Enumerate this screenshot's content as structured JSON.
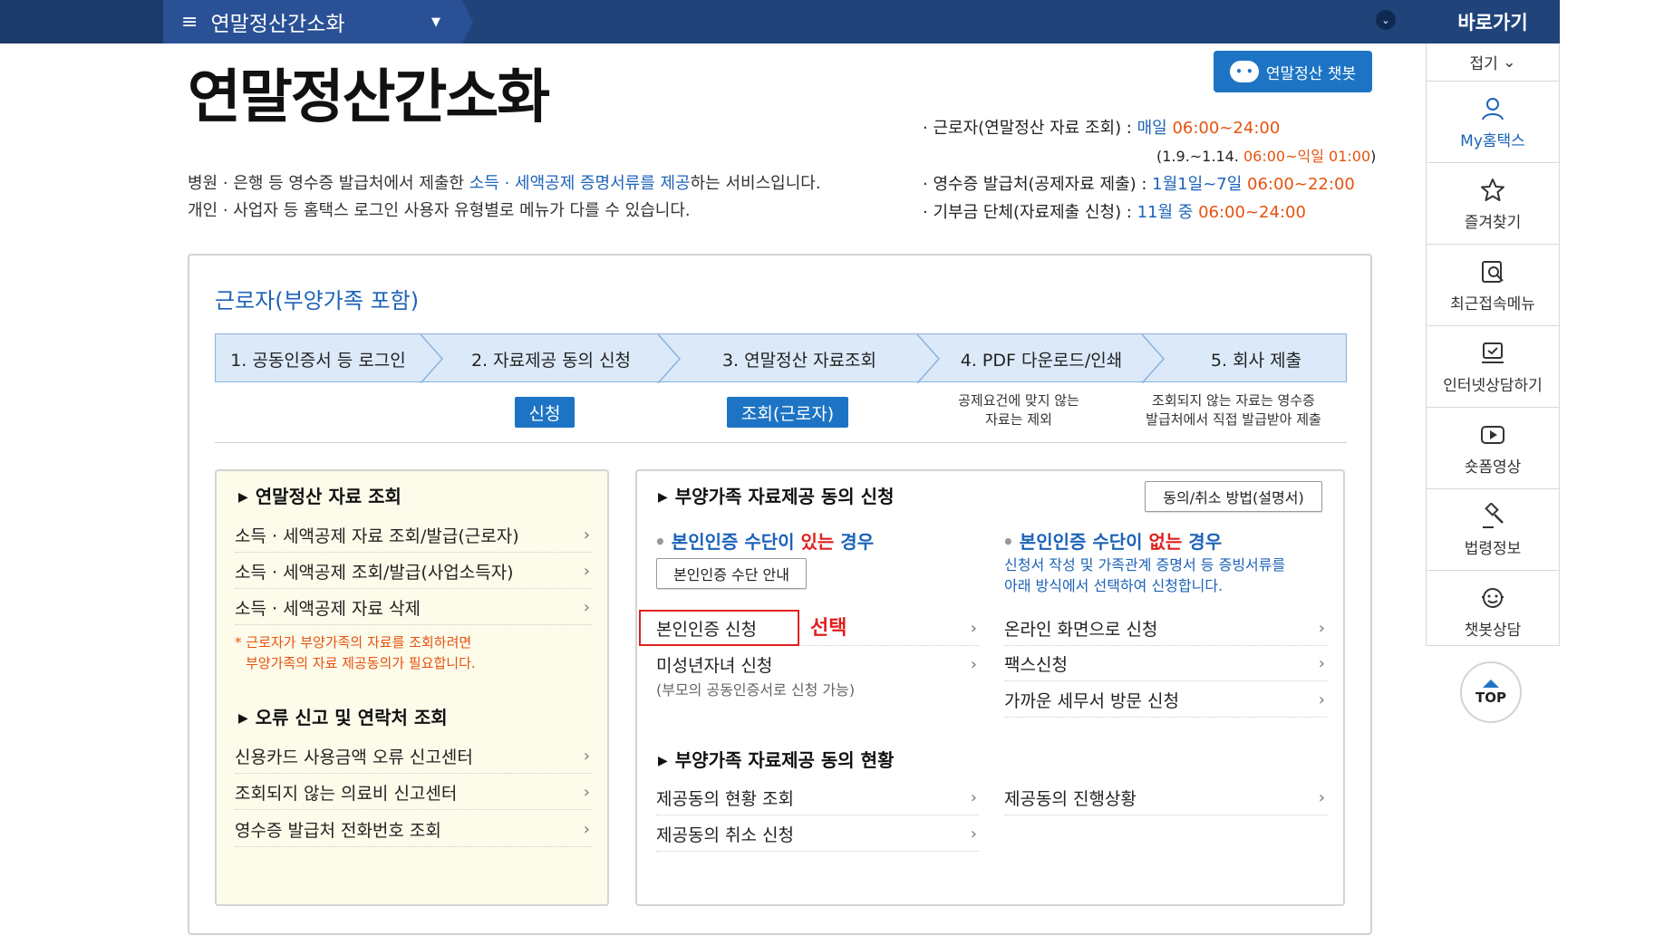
{
  "topbar": {
    "menu_title": "연말정산간소화",
    "quick_title": "바로가기"
  },
  "page": {
    "title": "연말정산간소화",
    "chatbot_button": "연말정산 챗봇",
    "desc_line1_a": "병원 · 은행 등 영수증 발급처에서 제출한 ",
    "desc_line1_hl": "소득 · 세액공제 증명서류를 제공",
    "desc_line1_b": "하는 서비스입니다.",
    "desc_line2": "개인 · 사업자 등 홈택스 로그인 사용자 유형별로 메뉴가 다를 수 있습니다."
  },
  "hours": {
    "r1_label": "· 근로자(연말정산 자료 조회) : ",
    "r1_day": "매일 ",
    "r1_time": "06:00~24:00",
    "r1_sub_a": "(1.9.~1.14. ",
    "r1_sub_b": "06:00~익일 01:00",
    "r1_sub_c": ")",
    "r2_label": "· 영수증 발급처(공제자료 제출) : ",
    "r2_day": "1월1일~7일 ",
    "r2_time": "06:00~22:00",
    "r3_label": "· 기부금 단체(자료제출 신청) : ",
    "r3_day": "11월 중 ",
    "r3_time": "06:00~24:00"
  },
  "card": {
    "title": "근로자(부양가족 포함)",
    "steps": [
      {
        "label": "1. 공동인증서 등 로그인"
      },
      {
        "label": "2. 자료제공 동의 신청"
      },
      {
        "label": "3. 연말정산 자료조회"
      },
      {
        "label": "4. PDF 다운로드/인쇄"
      },
      {
        "label": "5. 회사 제출"
      }
    ],
    "step2_action": "신청",
    "step3_action": "조회(근로자)",
    "step4_note_1": "공제요건에 맞지 않는",
    "step4_note_2": "자료는 제외",
    "step5_note_1": "조회되지 않는 자료는 영수증",
    "step5_note_2": "발급처에서 직접 발급받아 제출"
  },
  "left": {
    "section1_title": "연말정산 자료 조회",
    "section1_links": [
      "소득 · 세액공제 자료 조회/발급(근로자)",
      "소득 · 세액공제 조회/발급(사업소득자)",
      "소득 · 세액공제 자료 삭제"
    ],
    "note_1": "* 근로자가 부양가족의 자료를 조회하려면",
    "note_2": "부양가족의 자료 제공동의가 필요합니다.",
    "section2_title": "오류 신고 및 연락처 조회",
    "section2_links": [
      "신용카드 사용금액 오류 신고센터",
      "조회되지 않는 의료비 신고센터",
      "영수증 발급처 전화번호 조회"
    ]
  },
  "right": {
    "section1_title": "부양가족 자료제공 동의 신청",
    "manual_button": "동의/취소 방법(설명서)",
    "case1_a": "본인인증 수단이 ",
    "case1_emph": "있는",
    "case1_b": " 경우",
    "case1_button": "본인인증 수단 안내",
    "case1_links": [
      "본인인증 신청",
      "미성년자녀 신청"
    ],
    "case1_sub": "(부모의 공동인증서로 신청 가능)",
    "select_label": "선택",
    "case2_a": "본인인증 수단이 ",
    "case2_emph": "없는",
    "case2_b": " 경우",
    "case2_desc_1": "신청서 작성 및 가족관계 증명서 등 증빙서류를",
    "case2_desc_2": "아래 방식에서 선택하여 신청합니다.",
    "case2_links": [
      "온라인 화면으로 신청",
      "팩스신청",
      "가까운 세무서 방문 신청"
    ],
    "section2_title": "부양가족 자료제공 동의 현황",
    "section2_left_links": [
      "제공동의 현황 조회",
      "제공동의 취소 신청"
    ],
    "section2_right_links": [
      "제공동의 진행상황"
    ]
  },
  "quick": {
    "fold": "접기",
    "items": [
      {
        "label": "My홈택스",
        "icon": "person-icon"
      },
      {
        "label": "즐겨찾기",
        "icon": "star-icon"
      },
      {
        "label": "최근접속메뉴",
        "icon": "recent-search-icon"
      },
      {
        "label": "인터넷상담하기",
        "icon": "monitor-check-icon"
      },
      {
        "label": "숏폼영상",
        "icon": "play-icon"
      },
      {
        "label": "법령정보",
        "icon": "gavel-icon"
      },
      {
        "label": "챗봇상담",
        "icon": "chatbot-icon"
      }
    ],
    "top": "TOP"
  },
  "colors": {
    "header_navy": "#20447a",
    "accent_blue": "#1d74c4",
    "link_blue": "#1d63b8",
    "highlight_red": "#e0201f",
    "orange": "#e5530f"
  }
}
